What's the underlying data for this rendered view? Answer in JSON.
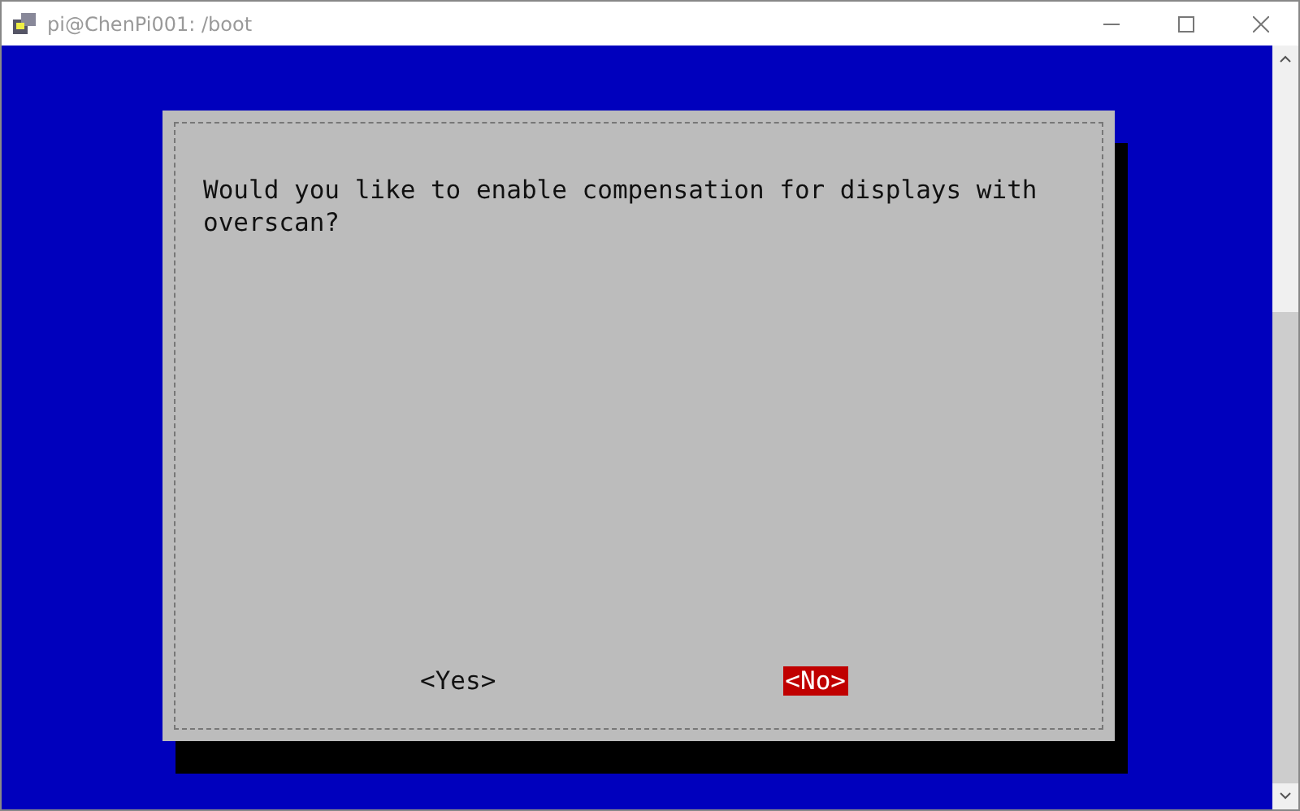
{
  "window": {
    "title": "pi@ChenPi001: /boot"
  },
  "dialog": {
    "message": "Would you like to enable compensation for displays with overscan?",
    "buttons": [
      {
        "label": "<Yes>",
        "selected": false
      },
      {
        "label": "<No>",
        "selected": true
      }
    ]
  }
}
